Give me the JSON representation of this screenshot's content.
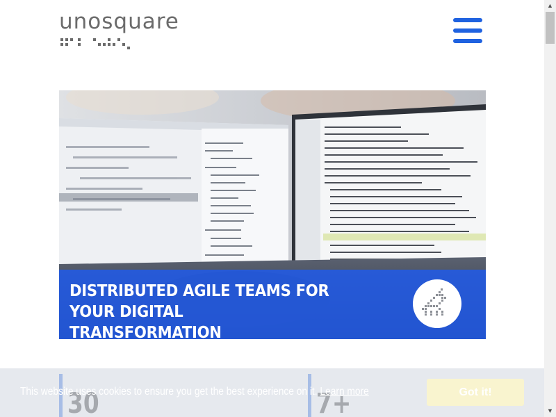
{
  "header": {
    "logo_text": "unosquare",
    "menu_icon": "hamburger-menu-icon"
  },
  "hero": {
    "title": "DISTRIBUTED AGILE TEAMS FOR YOUR DIGITAL\nTRANSFORMATION",
    "badge_icon": "unicorn-icon"
  },
  "stats": [
    {
      "value": "30"
    },
    {
      "value": "7+"
    }
  ],
  "cookie_banner": {
    "text": "This website uses cookies to ensure you get the best experience on it.",
    "link_label": "Learn more",
    "accept_label": "Got it!"
  },
  "colors": {
    "brand_blue": "#1f62e0",
    "logo_gray": "#6b6b6b"
  }
}
